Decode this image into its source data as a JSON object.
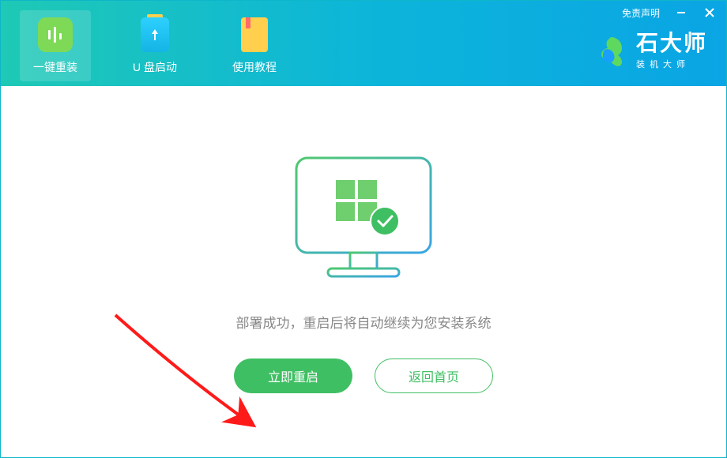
{
  "header": {
    "tabs": [
      {
        "label": "一键重装"
      },
      {
        "label": "U 盘启动"
      },
      {
        "label": "使用教程"
      }
    ],
    "disclaimer": "免责声明"
  },
  "brand": {
    "title": "石大师",
    "subtitle": "装机大师"
  },
  "main": {
    "status_message": "部署成功，重启后将自动继续为您安装系统",
    "restart_label": "立即重启",
    "home_label": "返回首页"
  },
  "colors": {
    "primary_green": "#3fbf63",
    "header_gradient_start": "#1fc9b5",
    "header_gradient_end": "#0aa5e5",
    "arrow": "#ff1a1a"
  }
}
